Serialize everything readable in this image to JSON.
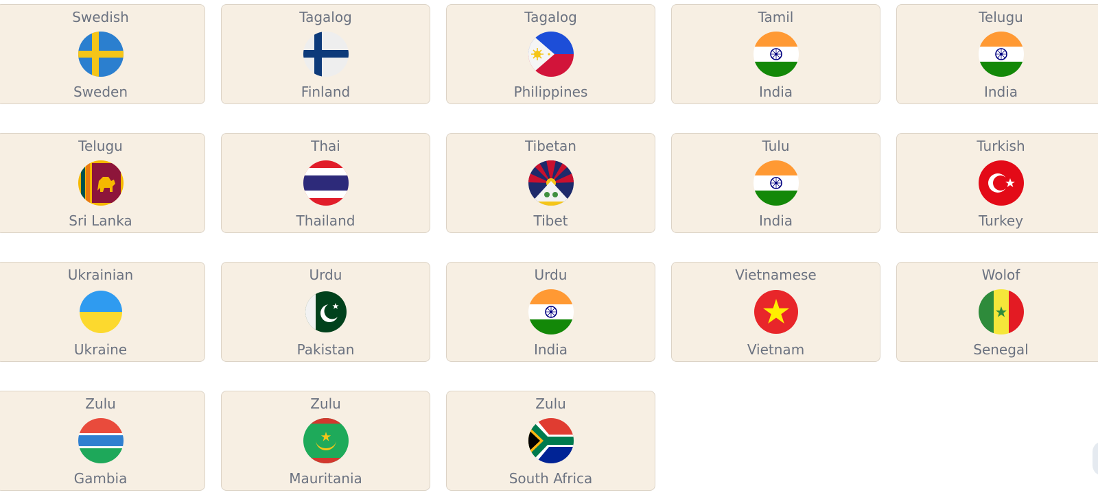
{
  "cards": [
    {
      "language": "Swedish",
      "country": "Sweden",
      "flag": "sweden-flag-icon"
    },
    {
      "language": "Tagalog",
      "country": "Finland",
      "flag": "finland-flag-icon"
    },
    {
      "language": "Tagalog",
      "country": "Philippines",
      "flag": "philippines-flag-icon"
    },
    {
      "language": "Tamil",
      "country": "India",
      "flag": "india-flag-icon"
    },
    {
      "language": "Telugu",
      "country": "India",
      "flag": "india-flag-icon"
    },
    {
      "language": "Telugu",
      "country": "Sri Lanka",
      "flag": "sri-lanka-flag-icon"
    },
    {
      "language": "Thai",
      "country": "Thailand",
      "flag": "thailand-flag-icon"
    },
    {
      "language": "Tibetan",
      "country": "Tibet",
      "flag": "tibet-flag-icon"
    },
    {
      "language": "Tulu",
      "country": "India",
      "flag": "india-flag-icon"
    },
    {
      "language": "Turkish",
      "country": "Turkey",
      "flag": "turkey-flag-icon"
    },
    {
      "language": "Ukrainian",
      "country": "Ukraine",
      "flag": "ukraine-flag-icon"
    },
    {
      "language": "Urdu",
      "country": "Pakistan",
      "flag": "pakistan-flag-icon"
    },
    {
      "language": "Urdu",
      "country": "India",
      "flag": "india-flag-icon"
    },
    {
      "language": "Vietnamese",
      "country": "Vietnam",
      "flag": "vietnam-flag-icon"
    },
    {
      "language": "Wolof",
      "country": "Senegal",
      "flag": "senegal-flag-icon"
    },
    {
      "language": "Zulu",
      "country": "Gambia",
      "flag": "gambia-flag-icon"
    },
    {
      "language": "Zulu",
      "country": "Mauritania",
      "flag": "mauritania-flag-icon"
    },
    {
      "language": "Zulu",
      "country": "South Africa",
      "flag": "south-africa-flag-icon"
    }
  ],
  "colors": {
    "card_bg": "#f7efe3",
    "card_border": "#dcd3c6",
    "text": "#6b7280"
  }
}
